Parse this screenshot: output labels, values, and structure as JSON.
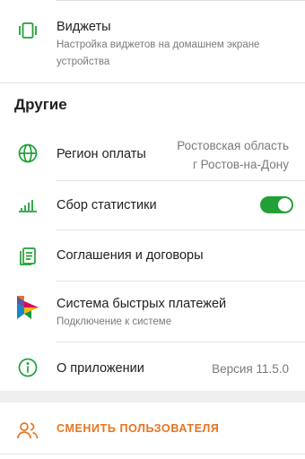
{
  "widgets": {
    "title": "Виджеты",
    "subtitle": "Настройка виджетов на домашнем экране устройства",
    "icon": "widgets-icon"
  },
  "section": {
    "title": "Другие"
  },
  "payment_region": {
    "title": "Регион оплаты",
    "value_line1": "Ростовская область",
    "value_line2": "г Ростов-на-Дону",
    "icon": "globe-icon"
  },
  "statistics": {
    "title": "Сбор статистики",
    "enabled": true,
    "icon": "signal-bars-icon"
  },
  "agreements": {
    "title": "Соглашения и договоры",
    "icon": "documents-icon"
  },
  "sbp": {
    "title": "Система быстрых платежей",
    "subtitle": "Подключение к системе",
    "icon": "sbp-logo-icon"
  },
  "about": {
    "title": "О приложении",
    "version": "Версия 11.5.0",
    "icon": "info-icon"
  },
  "switch_user": {
    "label": "СМЕНИТЬ ПОЛЬЗОВАТЕЛЯ",
    "icon": "users-icon"
  },
  "colors": {
    "accent_green": "#21a038",
    "accent_orange": "#e8741e",
    "secondary_text": "#7a7a7a"
  }
}
